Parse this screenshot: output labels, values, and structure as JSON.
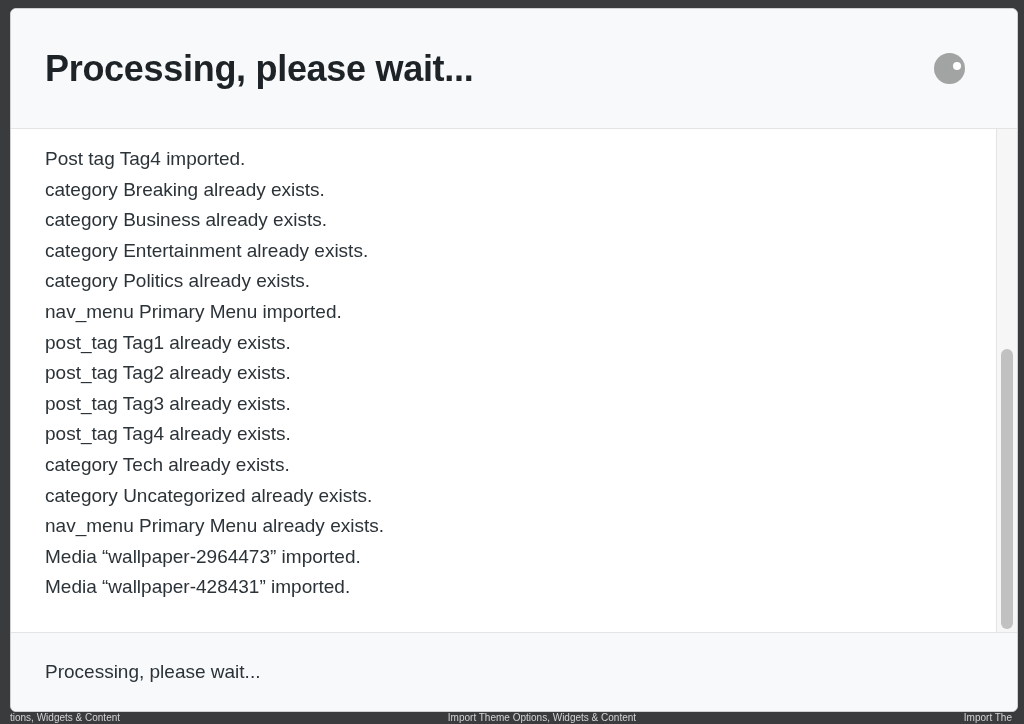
{
  "background": {
    "texts": [
      "tions, Widgets & Content",
      "Import Theme Options, Widgets & Content",
      "Import The"
    ]
  },
  "dialog": {
    "title": "Processing, please wait...",
    "log": [
      "Post tag Tag4 imported.",
      "category Breaking already exists.",
      "category Business already exists.",
      "category Entertainment already exists.",
      "category Politics already exists.",
      "nav_menu Primary Menu imported.",
      "post_tag Tag1 already exists.",
      "post_tag Tag2 already exists.",
      "post_tag Tag3 already exists.",
      "post_tag Tag4 already exists.",
      "category Tech already exists.",
      "category Uncategorized already exists.",
      "nav_menu Primary Menu already exists.",
      "Media “wallpaper-2964473” imported.",
      "Media “wallpaper-428431” imported."
    ],
    "footer": "Processing, please wait..."
  }
}
